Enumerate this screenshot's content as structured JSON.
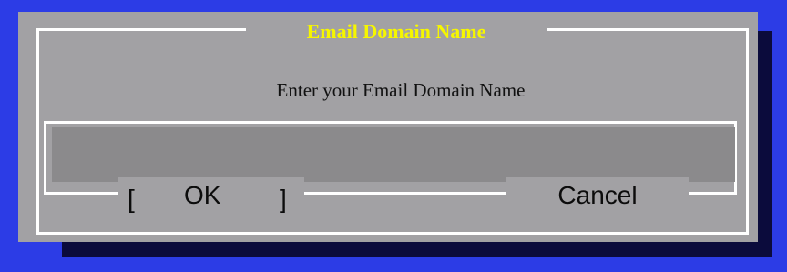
{
  "dialog": {
    "title": "Email Domain Name",
    "prompt": "Enter your Email Domain Name",
    "input_value": "",
    "buttons": {
      "ok_left_bracket": "[",
      "ok_label": "OK",
      "ok_right_bracket": "]",
      "cancel_label": "Cancel"
    }
  },
  "colors": {
    "background": "#2c3ce6",
    "dialog": "#a2a1a4",
    "shadow": "#0b0b3c",
    "title": "#f6f600",
    "input": "#8b8a8c",
    "frame": "#ffffff"
  }
}
